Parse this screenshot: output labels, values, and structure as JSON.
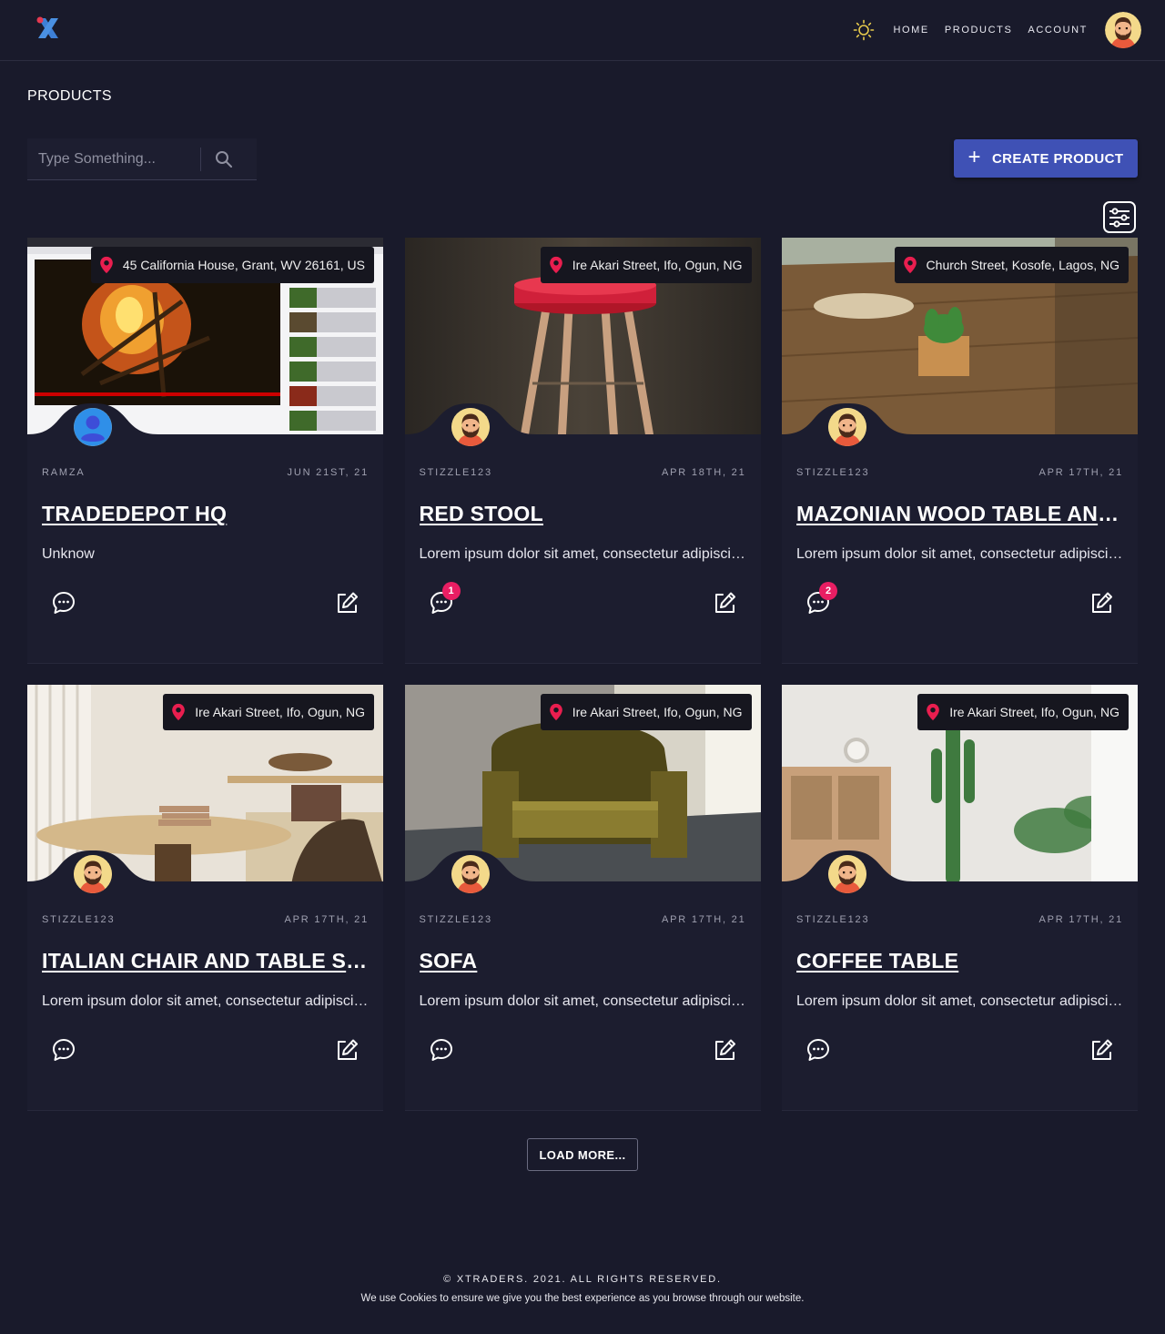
{
  "header": {
    "nav": [
      {
        "label": "HOME"
      },
      {
        "label": "PRODUCTS"
      },
      {
        "label": "ACCOUNT"
      }
    ]
  },
  "page": {
    "title": "PRODUCTS",
    "search_placeholder": "Type Something...",
    "create_label": "CREATE PRODUCT",
    "load_more_label": "LOAD MORE..."
  },
  "colors": {
    "background": "#191a2b",
    "card": "#1c1d2f",
    "accent": "#3f51b5",
    "badge": "#e91e63",
    "pin": "#e91e4f"
  },
  "products": [
    {
      "location": "45 California House, Grant, WV 26161, US",
      "user": "RAMZA",
      "date": "JUN 21ST, 21",
      "title": "TRADEDEPOT HQ",
      "description": "Unknow",
      "comments": null,
      "avatar": "person-placeholder-icon",
      "scene": "screenshot"
    },
    {
      "location": "Ire Akari Street, Ifo, Ogun, NG",
      "user": "STIZZLE123",
      "date": "APR 18TH, 21",
      "title": "RED STOOL",
      "description": "Lorem ipsum dolor sit amet, consectetur adipiscing elit.",
      "comments": "1",
      "avatar": "bearded-man-avatar",
      "scene": "stool"
    },
    {
      "location": "Church Street, Kosofe, Lagos, NG",
      "user": "STIZZLE123",
      "date": "APR 17TH, 21",
      "title": "MAZONIAN WOOD TABLE AND CHAIRS",
      "description": "Lorem ipsum dolor sit amet, consectetur adipiscing elit.",
      "comments": "2",
      "avatar": "bearded-man-avatar",
      "scene": "table"
    },
    {
      "location": "Ire Akari Street, Ifo, Ogun, NG",
      "user": "STIZZLE123",
      "date": "APR 17TH, 21",
      "title": "ITALIAN CHAIR AND TABLE SET",
      "description": "Lorem ipsum dolor sit amet, consectetur adipiscing elit.",
      "comments": null,
      "avatar": "bearded-man-avatar",
      "scene": "room"
    },
    {
      "location": "Ire Akari Street, Ifo, Ogun, NG",
      "user": "STIZZLE123",
      "date": "APR 17TH, 21",
      "title": "SOFA",
      "description": "Lorem ipsum dolor sit amet, consectetur adipiscing elit.",
      "comments": null,
      "avatar": "bearded-man-avatar",
      "scene": "sofa"
    },
    {
      "location": "Ire Akari Street, Ifo, Ogun, NG",
      "user": "STIZZLE123",
      "date": "APR 17TH, 21",
      "title": "COFFEE TABLE",
      "description": "Lorem ipsum dolor sit amet, consectetur adipiscing elit.",
      "comments": null,
      "avatar": "bearded-man-avatar",
      "scene": "coffee"
    }
  ],
  "footer": {
    "copyright": "© XTRADERS. 2021. ALL RIGHTS RESERVED.",
    "cookies": "We use Cookies to ensure we give you the best experience as you browse through our website."
  }
}
